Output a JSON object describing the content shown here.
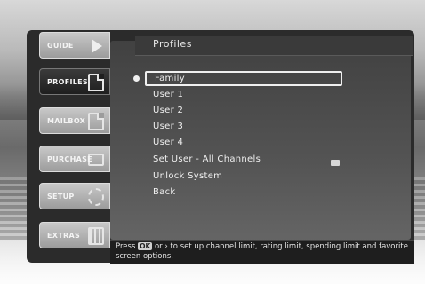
{
  "title": "Profiles",
  "nav": {
    "guide": "GUIDE",
    "profiles": "PROFILES",
    "mailbox": "MAILBOX",
    "purchase": "PURCHASE",
    "setup": "SETUP",
    "extras": "EXTRAS"
  },
  "menu": {
    "items": [
      "Family",
      "User 1",
      "User 2",
      "User 3",
      "User 4",
      "Set User - All Channels",
      "Unlock System",
      "Back"
    ],
    "selected_index": 0
  },
  "help": {
    "prefix": "Press",
    "key": "OK",
    "suffix": "or › to set up channel limit, rating limit, spending limit and favorite screen options."
  },
  "icons": {
    "guide": "arrow-right-icon",
    "profiles": "profile-doc-icon",
    "mailbox": "mail-doc-icon",
    "purchase": "tv-icon",
    "setup": "gear-icon",
    "extras": "grid-icon"
  }
}
